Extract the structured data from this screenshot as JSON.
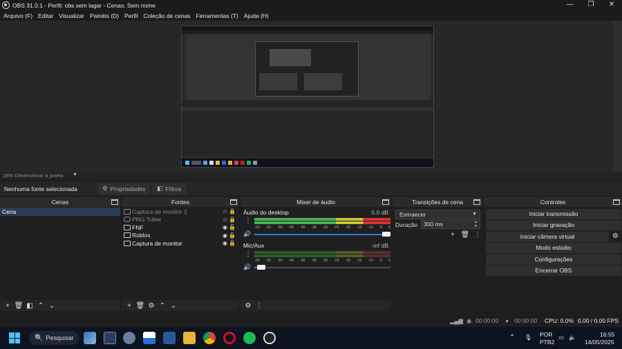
{
  "window": {
    "title": "OBS 31.0.1 - Perfil: obs sem lagar - Cenas: Sem nome",
    "controls": {
      "minimize": "—",
      "maximize": "❐",
      "close": "✕"
    }
  },
  "menu": [
    "Arquivo (F)",
    "Editar",
    "Visualizar",
    "Painéis (D)",
    "Perfil",
    "Coleção de cenas",
    "Ferramentas (T)",
    "Ajuda (H)"
  ],
  "preview": {
    "zoom_label": "28% Dimensionar à janela",
    "dropdown_caret": "▼"
  },
  "source_toolbar": {
    "no_source": "Nenhuma fonte selecionada",
    "properties": "Propriedades",
    "filters": "Filtros"
  },
  "scenes": {
    "title": "Cenas",
    "items": [
      "Cena"
    ]
  },
  "sources": {
    "title": "Fontes",
    "items": [
      {
        "name": "Captura de monitor 2",
        "visible": false,
        "locked": true
      },
      {
        "name": "PNG Tuber",
        "visible": false,
        "locked": true
      },
      {
        "name": "FNF",
        "visible": true,
        "locked": false
      },
      {
        "name": "Roblox",
        "visible": true,
        "locked": false
      },
      {
        "name": "Captura de monitor",
        "visible": true,
        "locked": false
      }
    ]
  },
  "mixer": {
    "title": "Mixer de áudio",
    "tick_labels": [
      "-60",
      "-55",
      "-50",
      "-45",
      "-40",
      "-35",
      "-30",
      "-25",
      "-20",
      "-15",
      "-10",
      "-5",
      "0"
    ],
    "channels": [
      {
        "name": "Áudio do desktop",
        "db": "0.0 dB",
        "level": 1.0,
        "volume": 0.97
      },
      {
        "name": "Mic/Aux",
        "db": "-inf dB",
        "level": 0.0,
        "volume": 0.05
      }
    ]
  },
  "transitions": {
    "title": "Transições de cena",
    "selected": "Esmaecer",
    "duration_label": "Duração",
    "duration_value": "300 ms"
  },
  "controls": {
    "title": "Controles",
    "buttons": [
      "Iniciar transmissão",
      "Iniciar gravação",
      "Iniciar câmera virtual",
      "Modo estúdio",
      "Configurações",
      "Encerrar OBS"
    ]
  },
  "status": {
    "stream_time": "00:00:00",
    "rec_time": "00:00:00",
    "cpu": "CPU: 0.0%",
    "fps": "0.00 / 0.00 FPS"
  },
  "taskbar": {
    "search": "Pesquisar",
    "lang_top": "POR",
    "lang_bottom": "PTB2",
    "time": "16:55",
    "date": "14/05/2025"
  }
}
